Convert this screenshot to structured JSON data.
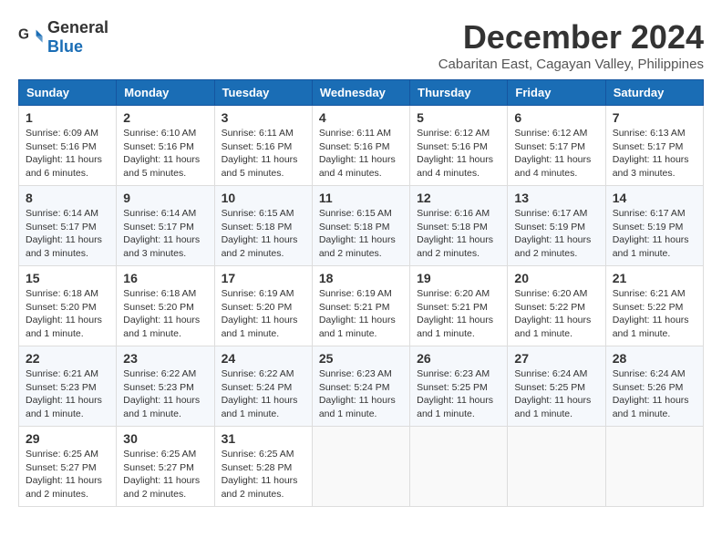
{
  "logo": {
    "general": "General",
    "blue": "Blue"
  },
  "title": "December 2024",
  "location": "Cabaritan East, Cagayan Valley, Philippines",
  "days_of_week": [
    "Sunday",
    "Monday",
    "Tuesday",
    "Wednesday",
    "Thursday",
    "Friday",
    "Saturday"
  ],
  "weeks": [
    [
      {
        "day": "1",
        "sunrise": "6:09 AM",
        "sunset": "5:16 PM",
        "daylight": "11 hours and 6 minutes."
      },
      {
        "day": "2",
        "sunrise": "6:10 AM",
        "sunset": "5:16 PM",
        "daylight": "11 hours and 5 minutes."
      },
      {
        "day": "3",
        "sunrise": "6:11 AM",
        "sunset": "5:16 PM",
        "daylight": "11 hours and 5 minutes."
      },
      {
        "day": "4",
        "sunrise": "6:11 AM",
        "sunset": "5:16 PM",
        "daylight": "11 hours and 4 minutes."
      },
      {
        "day": "5",
        "sunrise": "6:12 AM",
        "sunset": "5:16 PM",
        "daylight": "11 hours and 4 minutes."
      },
      {
        "day": "6",
        "sunrise": "6:12 AM",
        "sunset": "5:17 PM",
        "daylight": "11 hours and 4 minutes."
      },
      {
        "day": "7",
        "sunrise": "6:13 AM",
        "sunset": "5:17 PM",
        "daylight": "11 hours and 3 minutes."
      }
    ],
    [
      {
        "day": "8",
        "sunrise": "6:14 AM",
        "sunset": "5:17 PM",
        "daylight": "11 hours and 3 minutes."
      },
      {
        "day": "9",
        "sunrise": "6:14 AM",
        "sunset": "5:17 PM",
        "daylight": "11 hours and 3 minutes."
      },
      {
        "day": "10",
        "sunrise": "6:15 AM",
        "sunset": "5:18 PM",
        "daylight": "11 hours and 2 minutes."
      },
      {
        "day": "11",
        "sunrise": "6:15 AM",
        "sunset": "5:18 PM",
        "daylight": "11 hours and 2 minutes."
      },
      {
        "day": "12",
        "sunrise": "6:16 AM",
        "sunset": "5:18 PM",
        "daylight": "11 hours and 2 minutes."
      },
      {
        "day": "13",
        "sunrise": "6:17 AM",
        "sunset": "5:19 PM",
        "daylight": "11 hours and 2 minutes."
      },
      {
        "day": "14",
        "sunrise": "6:17 AM",
        "sunset": "5:19 PM",
        "daylight": "11 hours and 1 minute."
      }
    ],
    [
      {
        "day": "15",
        "sunrise": "6:18 AM",
        "sunset": "5:20 PM",
        "daylight": "11 hours and 1 minute."
      },
      {
        "day": "16",
        "sunrise": "6:18 AM",
        "sunset": "5:20 PM",
        "daylight": "11 hours and 1 minute."
      },
      {
        "day": "17",
        "sunrise": "6:19 AM",
        "sunset": "5:20 PM",
        "daylight": "11 hours and 1 minute."
      },
      {
        "day": "18",
        "sunrise": "6:19 AM",
        "sunset": "5:21 PM",
        "daylight": "11 hours and 1 minute."
      },
      {
        "day": "19",
        "sunrise": "6:20 AM",
        "sunset": "5:21 PM",
        "daylight": "11 hours and 1 minute."
      },
      {
        "day": "20",
        "sunrise": "6:20 AM",
        "sunset": "5:22 PM",
        "daylight": "11 hours and 1 minute."
      },
      {
        "day": "21",
        "sunrise": "6:21 AM",
        "sunset": "5:22 PM",
        "daylight": "11 hours and 1 minute."
      }
    ],
    [
      {
        "day": "22",
        "sunrise": "6:21 AM",
        "sunset": "5:23 PM",
        "daylight": "11 hours and 1 minute."
      },
      {
        "day": "23",
        "sunrise": "6:22 AM",
        "sunset": "5:23 PM",
        "daylight": "11 hours and 1 minute."
      },
      {
        "day": "24",
        "sunrise": "6:22 AM",
        "sunset": "5:24 PM",
        "daylight": "11 hours and 1 minute."
      },
      {
        "day": "25",
        "sunrise": "6:23 AM",
        "sunset": "5:24 PM",
        "daylight": "11 hours and 1 minute."
      },
      {
        "day": "26",
        "sunrise": "6:23 AM",
        "sunset": "5:25 PM",
        "daylight": "11 hours and 1 minute."
      },
      {
        "day": "27",
        "sunrise": "6:24 AM",
        "sunset": "5:25 PM",
        "daylight": "11 hours and 1 minute."
      },
      {
        "day": "28",
        "sunrise": "6:24 AM",
        "sunset": "5:26 PM",
        "daylight": "11 hours and 1 minute."
      }
    ],
    [
      {
        "day": "29",
        "sunrise": "6:25 AM",
        "sunset": "5:27 PM",
        "daylight": "11 hours and 2 minutes."
      },
      {
        "day": "30",
        "sunrise": "6:25 AM",
        "sunset": "5:27 PM",
        "daylight": "11 hours and 2 minutes."
      },
      {
        "day": "31",
        "sunrise": "6:25 AM",
        "sunset": "5:28 PM",
        "daylight": "11 hours and 2 minutes."
      },
      null,
      null,
      null,
      null
    ]
  ]
}
